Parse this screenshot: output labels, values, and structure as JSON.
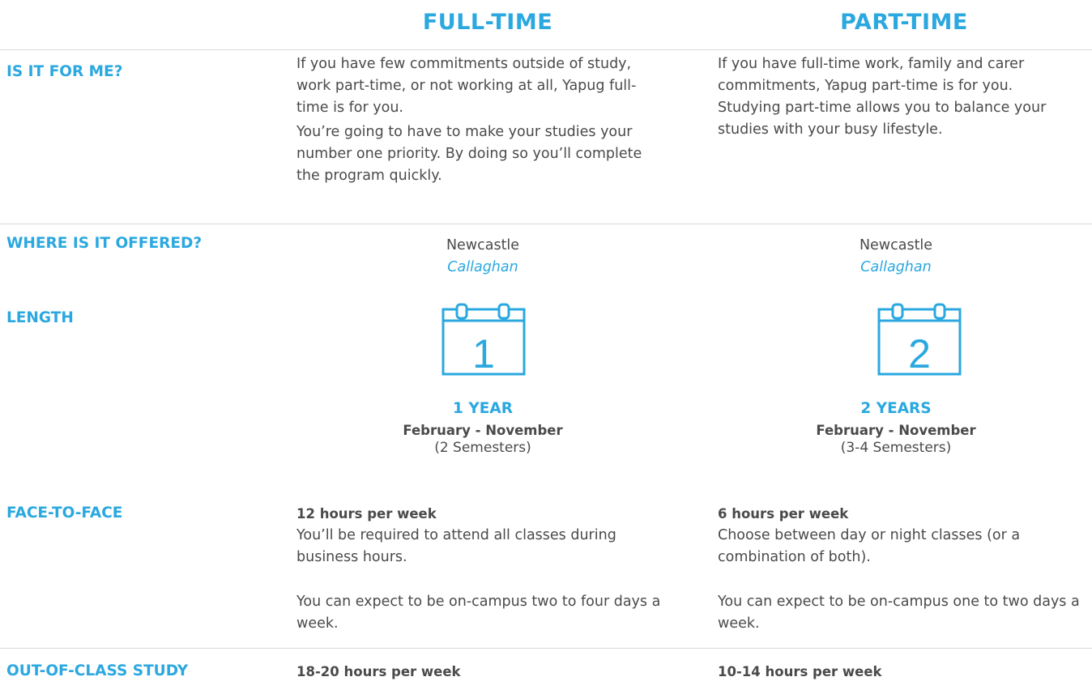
{
  "headers": {
    "full_time": "FULL-TIME",
    "part_time": "PART-TIME"
  },
  "rows": {
    "is_it_for_me": {
      "label": "IS IT FOR ME?",
      "full_time": [
        "If you have few commitments outside of study, work part-time, or not working at all, Yapug full-time is for you.",
        "You’re going to have to make your studies your number one priority. By doing so you’ll complete the program quickly."
      ],
      "part_time": [
        "If you have full-time work, family and carer commitments, Yapug part-time is for you.",
        "Studying part-time allows you to balance your studies with your busy lifestyle."
      ]
    },
    "where": {
      "label": "WHERE IS IT OFFERED?",
      "full_time": {
        "city": "Newcastle",
        "campus": "Callaghan"
      },
      "part_time": {
        "city": "Newcastle",
        "campus": "Callaghan"
      }
    },
    "length": {
      "label": "LENGTH",
      "full_time": {
        "calendar_number": "1",
        "duration": "1 YEAR",
        "months": "February - November",
        "semesters": "(2 Semesters)"
      },
      "part_time": {
        "calendar_number": "2",
        "duration": "2 YEARS",
        "months": "February - November",
        "semesters": "(3-4 Semesters)"
      }
    },
    "face_to_face": {
      "label": "FACE-TO-FACE",
      "full_time": {
        "hours": "12 hours per week",
        "paras": [
          "You’ll be required to attend all classes during business hours.",
          "You can expect to be on-campus two to four days a week."
        ]
      },
      "part_time": {
        "hours": "6 hours per week",
        "paras": [
          "Choose between day or night classes (or a combination of both).",
          "You can expect to be on-campus one to two days a week."
        ]
      }
    },
    "out_of_class": {
      "label": "OUT-OF-CLASS STUDY",
      "full_time": {
        "hours": "18-20 hours per week"
      },
      "part_time": {
        "hours": "10-14 hours per week"
      }
    }
  },
  "colors": {
    "accent": "#2aa8df",
    "text": "#4a4a4a",
    "divider": "#d9d9d9"
  },
  "icons": {
    "calendar": "calendar-icon"
  }
}
